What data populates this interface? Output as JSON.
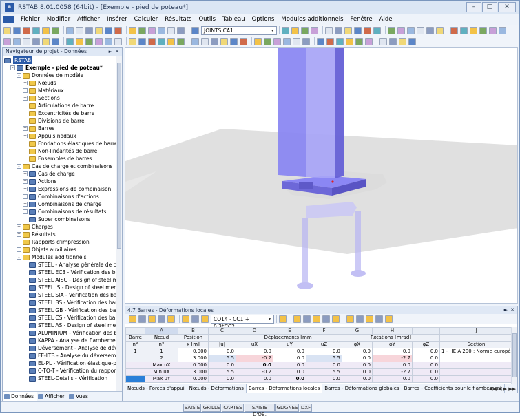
{
  "window": {
    "title": "RSTAB 8.01.0058 (64bit) - [Exemple - pied de poteau*]"
  },
  "menu": [
    "Fichier",
    "Modifier",
    "Afficher",
    "Insérer",
    "Calculer",
    "Résultats",
    "Outils",
    "Tableau",
    "Options",
    "Modules additionnels",
    "Fenêtre",
    "Aide"
  ],
  "toolbar": {
    "load_combo": "JOINTS CA1"
  },
  "navigator": {
    "title": "Navigateur de projet - Données",
    "tree": [
      {
        "label": "RSTAB",
        "level": 0,
        "selected": true,
        "expander": "",
        "icon": "mod"
      },
      {
        "label": "Exemple - pied de poteau*",
        "level": 1,
        "bold": true,
        "expander": "-",
        "icon": "mod"
      },
      {
        "label": "Données de modèle",
        "level": 2,
        "expander": "-",
        "icon": "fold"
      },
      {
        "label": "Nœuds",
        "level": 3,
        "expander": "+",
        "icon": "fold"
      },
      {
        "label": "Matériaux",
        "level": 3,
        "expander": "+",
        "icon": "fold"
      },
      {
        "label": "Sections",
        "level": 3,
        "expander": "+",
        "icon": "fold"
      },
      {
        "label": "Articulations de barre",
        "level": 3,
        "expander": "",
        "icon": "fold"
      },
      {
        "label": "Excentricités de barre",
        "level": 3,
        "expander": "",
        "icon": "fold"
      },
      {
        "label": "Divisions de barre",
        "level": 3,
        "expander": "",
        "icon": "fold"
      },
      {
        "label": "Barres",
        "level": 3,
        "expander": "+",
        "icon": "fold"
      },
      {
        "label": "Appuis nodaux",
        "level": 3,
        "expander": "+",
        "icon": "fold"
      },
      {
        "label": "Fondations élastiques de barre",
        "level": 3,
        "expander": "",
        "icon": "fold"
      },
      {
        "label": "Non-linéarités de barre",
        "level": 3,
        "expander": "",
        "icon": "fold"
      },
      {
        "label": "Ensembles de barres",
        "level": 3,
        "expander": "",
        "icon": "fold"
      },
      {
        "label": "Cas de charge et combinaisons",
        "level": 2,
        "expander": "-",
        "icon": "fold"
      },
      {
        "label": "Cas de charge",
        "level": 3,
        "expander": "+",
        "icon": "mod"
      },
      {
        "label": "Actions",
        "level": 3,
        "expander": "+",
        "icon": "mod"
      },
      {
        "label": "Expressions de combinaison",
        "level": 3,
        "expander": "+",
        "icon": "mod"
      },
      {
        "label": "Combinaisons d'actions",
        "level": 3,
        "expander": "+",
        "icon": "mod"
      },
      {
        "label": "Combinaisons de charge",
        "level": 3,
        "expander": "+",
        "icon": "mod"
      },
      {
        "label": "Combinaisons de résultats",
        "level": 3,
        "expander": "+",
        "icon": "mod"
      },
      {
        "label": "Super combinaisons",
        "level": 3,
        "expander": "",
        "icon": "mod"
      },
      {
        "label": "Charges",
        "level": 2,
        "expander": "+",
        "icon": "fold"
      },
      {
        "label": "Résultats",
        "level": 2,
        "expander": "+",
        "icon": "fold"
      },
      {
        "label": "Rapports d'impression",
        "level": 2,
        "expander": "",
        "icon": "fold"
      },
      {
        "label": "Objets auxiliaires",
        "level": 2,
        "expander": "+",
        "icon": "fold"
      },
      {
        "label": "Modules additionnels",
        "level": 2,
        "expander": "-",
        "icon": "fold"
      },
      {
        "label": "STEEL - Analyse générale de con",
        "level": 3,
        "expander": "",
        "icon": "mod"
      },
      {
        "label": "STEEL EC3 - Vérification des barr",
        "level": 3,
        "expander": "",
        "icon": "mod"
      },
      {
        "label": "STEEL AISC - Design of steel mer",
        "level": 3,
        "expander": "",
        "icon": "mod"
      },
      {
        "label": "STEEL IS - Design of steel membe",
        "level": 3,
        "expander": "",
        "icon": "mod"
      },
      {
        "label": "STEEL SIA - Vérification des barre",
        "level": 3,
        "expander": "",
        "icon": "mod"
      },
      {
        "label": "STEEL BS - Vérification des barre",
        "level": 3,
        "expander": "",
        "icon": "mod"
      },
      {
        "label": "STEEL GB - Vérification des barre",
        "level": 3,
        "expander": "",
        "icon": "mod"
      },
      {
        "label": "STEEL CS - Vérification des barre",
        "level": 3,
        "expander": "",
        "icon": "mod"
      },
      {
        "label": "STEEL AS - Design of steel memb",
        "level": 3,
        "expander": "",
        "icon": "mod"
      },
      {
        "label": "ALUMINIUM - Vérification des ba",
        "level": 3,
        "expander": "",
        "icon": "mod"
      },
      {
        "label": "KAPPA - Analyse de flambement",
        "level": 3,
        "expander": "",
        "icon": "mod"
      },
      {
        "label": "Déversement - Analyse de déver",
        "level": 3,
        "expander": "",
        "icon": "mod"
      },
      {
        "label": "FE-LTB - Analyse du déversemer",
        "level": 3,
        "expander": "",
        "icon": "mod"
      },
      {
        "label": "EL-PL - Vérification élastique-pla",
        "level": 3,
        "expander": "",
        "icon": "mod"
      },
      {
        "label": "C-TO-T - Vérification du rapport",
        "level": 3,
        "expander": "",
        "icon": "mod"
      },
      {
        "label": "STEEL-Details - Vérification",
        "level": 3,
        "expander": "",
        "icon": "mod"
      }
    ],
    "tabs": [
      "Données",
      "Afficher",
      "Vues"
    ]
  },
  "results": {
    "title": "4.7 Barres - Déformations locales",
    "combo": "CO14 - CC1 + 0.3*CC2",
    "col_letters": [
      "",
      "A",
      "B",
      "C",
      "D",
      "E",
      "F",
      "G",
      "H",
      "I",
      "J"
    ],
    "headers": {
      "barre": "Barre",
      "barre_n": "n°",
      "noeud": "Nœud",
      "noeud_n": "n°",
      "position": "Position",
      "position_unit": "x [m]",
      "disp_group": "Déplacements [mm]",
      "rot_group": "Rotations [mrad]",
      "u": "|u|",
      "ux": "uX",
      "uy": "uY",
      "uz": "uZ",
      "phix": "φX",
      "phiy": "φY",
      "phiz": "φZ",
      "section": "Section"
    },
    "rows": [
      {
        "barre": "1",
        "noeud": "1",
        "x": "0.000",
        "u": "0.0",
        "ux": "0.0",
        "uy": "0.0",
        "uz": "0.0",
        "phix": "0.0",
        "phiy": "0.0",
        "phiz": "0.0",
        "section": "1 - HE A 200 ; Norme européen",
        "cls": ""
      },
      {
        "barre": "",
        "noeud": "2",
        "x": "3.000",
        "u": "5.5",
        "ux": "-0.2",
        "uy": "0.0",
        "uz": "5.5",
        "phix": "0.0",
        "phiy": "-2.7",
        "phiz": "0.0",
        "section": "",
        "cls": ""
      },
      {
        "barre": "",
        "noeud": "Max uX",
        "x": "0.000",
        "u": "0.0",
        "ux": "0.0",
        "uy": "0.0",
        "uz": "0.0",
        "phix": "0.0",
        "phiy": "0.0",
        "phiz": "0.0",
        "section": "",
        "cls": "lav"
      },
      {
        "barre": "",
        "noeud": "Min uX",
        "x": "3.000",
        "u": "5.5",
        "ux": "-0.2",
        "uy": "0.0",
        "uz": "5.5",
        "phix": "0.0",
        "phiy": "-2.7",
        "phiz": "0.0",
        "section": "",
        "cls": "lav"
      },
      {
        "barre": "",
        "noeud": "Max uY",
        "x": "0.000",
        "u": "0.0",
        "ux": "0.0",
        "uy": "0.0",
        "uz": "0.0",
        "phix": "0.0",
        "phiy": "0.0",
        "phiz": "0.0",
        "section": "",
        "cls": "lav"
      }
    ],
    "tabs": [
      "Nœuds - Forces d'appui",
      "Nœuds - Déformations",
      "Barres - Déformations locales",
      "Barres - Déformations globales",
      "Barres - Coefficients pour le flambement"
    ],
    "active_tab": 2
  },
  "statusbar": [
    "SAISIE",
    "GRILLE",
    "CARTES",
    "SAISIE D'OB.",
    "GLIGNES",
    "DXF"
  ],
  "colors": {
    "accent": "#2a5aa8",
    "column": "#7f7cf0",
    "pink": "#f7d5da"
  }
}
